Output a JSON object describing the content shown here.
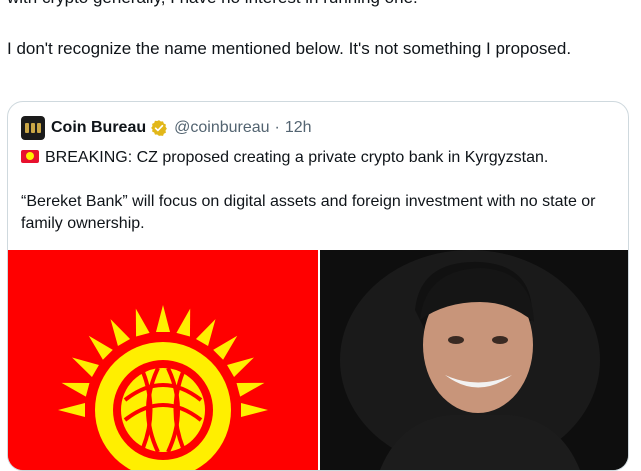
{
  "post": {
    "partial_line": "with crypto generally, I have no interest in running one.",
    "text": "I don't recognize the name mentioned below. It's not something I proposed."
  },
  "quote": {
    "author_name": "Coin Bureau",
    "handle": "@coinbureau",
    "separator": "·",
    "time": "12h",
    "line1": "BREAKING: CZ proposed creating a private crypto bank in Kyrgyzstan.",
    "line2": "“Bereket Bank” will focus on digital assets and foreign investment with no state or family ownership.",
    "verified_color": "#e2b719",
    "media": [
      {
        "icon": "kyrgyzstan-flag-image",
        "colors": {
          "field": "#ff0000",
          "sun": "#ffef00"
        }
      },
      {
        "icon": "person-photo"
      }
    ]
  },
  "colors": {
    "text": "#0f1419",
    "secondary": "#536471",
    "border": "#cfd9de"
  }
}
